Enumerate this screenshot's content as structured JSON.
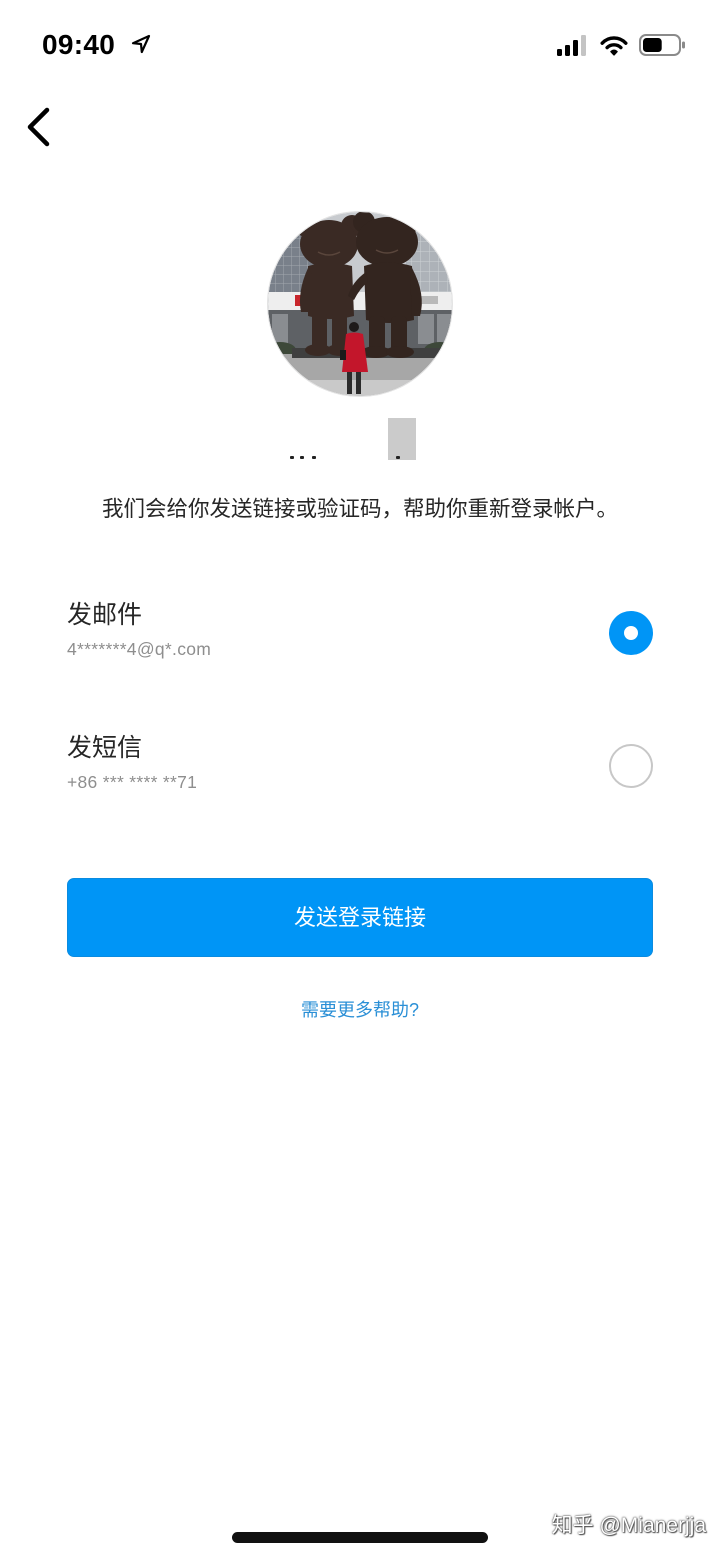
{
  "status_bar": {
    "time": "09:40",
    "location_icon": "location-arrow-icon",
    "signal_icon": "cellular-signal-icon",
    "signal_bars": 3,
    "signal_bars_total": 4,
    "wifi_icon": "wifi-icon",
    "battery_icon": "battery-icon",
    "battery_level": 0.55
  },
  "nav": {
    "back_icon": "chevron-left-icon"
  },
  "description": "我们会给你发送链接或验证码，帮助你重新登录帐户。",
  "options": [
    {
      "label": "发邮件",
      "detail": "4*******4@q*.com",
      "selected": true
    },
    {
      "label": "发短信",
      "detail": "+86 *** **** **71",
      "selected": false
    }
  ],
  "primary_button": {
    "label": "发送登录链接"
  },
  "help_link": {
    "label": "需要更多帮助?"
  },
  "watermark": "知乎 @Mianerjja",
  "colors": {
    "accent": "#0095f6",
    "link": "#2a8fd6",
    "text": "#262626",
    "secondary_text": "#8e8e8e",
    "radio_border": "#c7c7c7"
  }
}
